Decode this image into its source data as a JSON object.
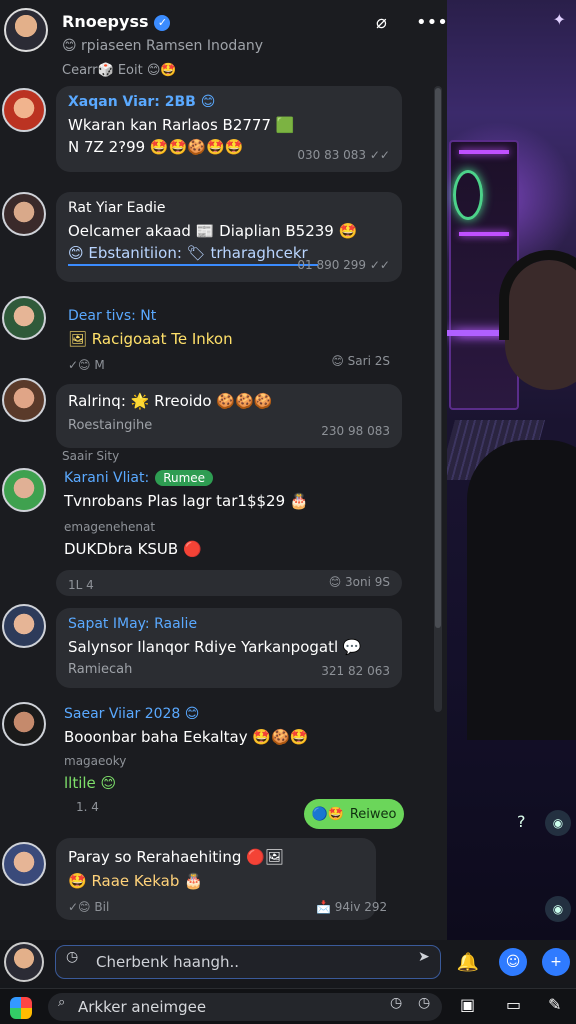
{
  "header": {
    "title": "Rnoepyss",
    "subtitle": "😊 rpiaseen Ramsen Inodany",
    "subtitle2": "Cearr🎲 Eoit 😊🤩"
  },
  "messages": [
    {
      "name": "Xaqan Viar: 2BB 😊",
      "name_color": "#5aa9ff",
      "lines": [
        "Wkaran kan Rarlaos B2777 🟩",
        "N 7Z 2?99 🤩🤩🍪🤩🤩"
      ],
      "time": "030 83 083 ✓✓"
    },
    {
      "name": "Rat Yiar Eadie",
      "name_color": "#ffffff",
      "lines": [
        "Oelcamer akaad 📰 Diaplian B5239 🤩",
        "😊 Ebstanitiion: 🏷 trharaghcekr"
      ],
      "time": "01 890 299 ✓✓"
    },
    {
      "name": "Dear tivs: Nt",
      "name_color": "#5aa9ff",
      "lines": [
        "🖼 Racigoaat Te Inkon"
      ],
      "meta_left": "✓😊 M",
      "time": "😊 Sari 2S"
    },
    {
      "name": "Ralrinq: 🌟 Rreoido 🍪🍪🍪",
      "name_color": "#ffffff",
      "lines": [
        "Roestaingihe"
      ],
      "time": "230 98 083"
    },
    {
      "pre": "Saair Sity",
      "name": "Karani Vliat:",
      "tag": "Rumee",
      "name_color": "#5aa9ff",
      "lines": [
        "Tvnrobans Plas lagr tar1$$29 🎂"
      ],
      "extra": "emagenehenat",
      "extra2": "DUKDbra KSUB 🔴",
      "meta_left": "1L 4",
      "time": "😊 3oni 9S"
    },
    {
      "name": "Sapat IMay: Raalie",
      "name_color": "#5aa9ff",
      "lines": [
        "Salynsor Ilanqor Rdiye Yarkanpogatl 💬"
      ],
      "sub": "Ramiecah",
      "time": "321 82 063"
    },
    {
      "name": "Saear Viiar 2028 😊",
      "name_color": "#5aa9ff",
      "lines": [
        "Booonbar baha Eekaltay 🤩🍪🤩"
      ],
      "sub": "magaeoky",
      "extra_green": "lltile 😊",
      "meta_left": "1. 4"
    },
    {
      "name": "",
      "lines": [
        "Paray so Rerahaehiting 🔴🖼",
        "🤩 Raae Kekab 🎂"
      ],
      "meta_left": "✓😊 Bil",
      "time": "📩 94iv 292"
    }
  ],
  "pill": {
    "label": "Reiweo"
  },
  "composer": {
    "placeholder": "Cherbenk haangh.."
  },
  "bottom": {
    "search_placeholder": "Arkker aneimgee"
  },
  "colors": {
    "accent": "#3b8cff",
    "pill": "#6bd65a",
    "tag": "#2e9d52"
  }
}
